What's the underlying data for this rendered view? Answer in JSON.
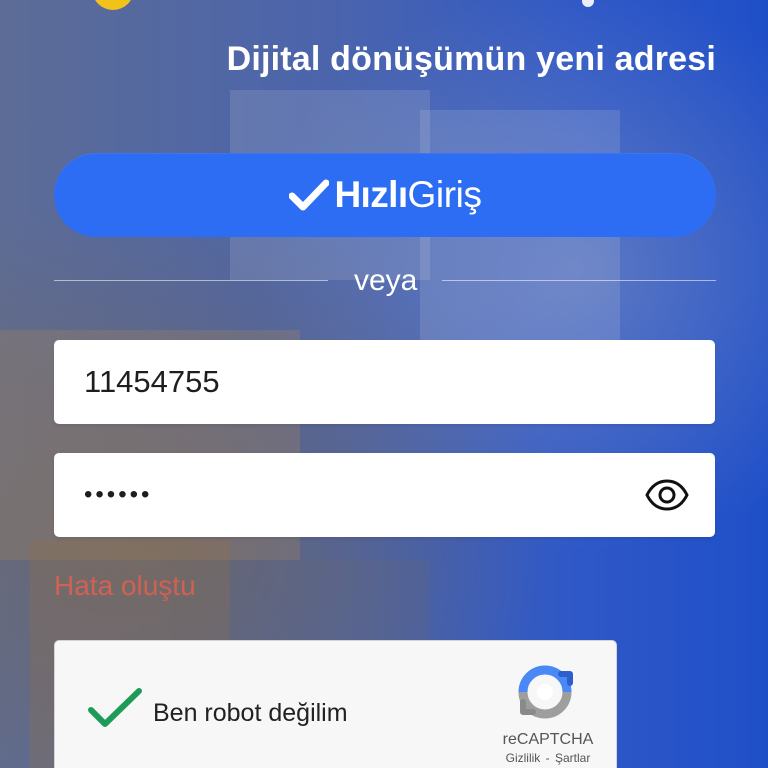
{
  "header": {
    "subtitle": "Dijital dönüşümün yeni adresi"
  },
  "quick_login": {
    "label_bold": "Hızlı",
    "label_regular": "Giriş",
    "icon": "check-icon"
  },
  "divider": {
    "text": "veya"
  },
  "form": {
    "username_value": "11454755",
    "password_value": "••••••",
    "password_icon": "eye-icon"
  },
  "status": {
    "error_text": "Hata oluştu"
  },
  "recaptcha": {
    "label": "Ben robot değilim",
    "brand": "reCAPTCHA",
    "privacy": "Gizlilik",
    "separator": "-",
    "terms": "Şartlar",
    "checked": true,
    "check_color": "#1e9b57"
  },
  "colors": {
    "primary_button": "#2d6df4",
    "error": "#ef5f4c",
    "logo_yellow": "#f2c21b"
  }
}
